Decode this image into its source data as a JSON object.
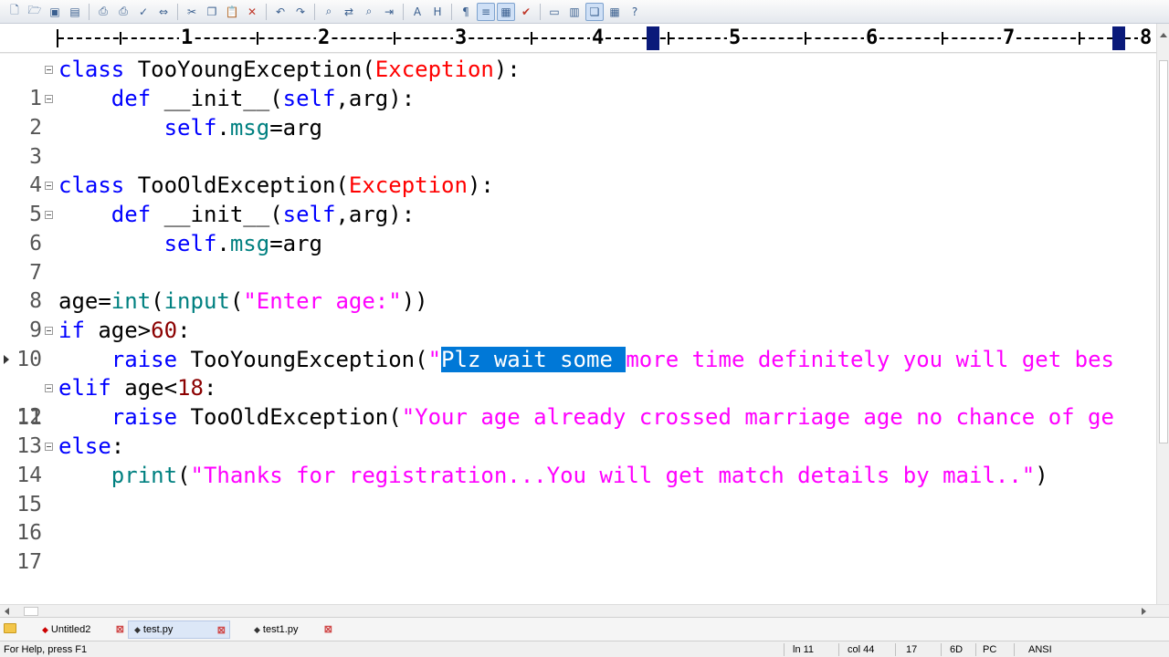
{
  "toolbar": {
    "buttons": [
      "new-file-icon",
      "open-folder-icon",
      "save-icon",
      "save-all-icon",
      "print-preview-icon",
      "print-icon",
      "spellcheck-icon",
      "compare-icon",
      "cut-icon",
      "copy-icon",
      "paste-icon",
      "delete-icon",
      "undo-icon",
      "redo-icon",
      "find-icon",
      "replace-icon",
      "find-in-files-icon",
      "goto-icon",
      "font-icon",
      "hex-icon",
      "format-icon",
      "word-wrap-icon",
      "column-mode-icon",
      "check-icon",
      "window-icon",
      "window-tile-icon",
      "window-cascade-icon",
      "window-arrange-icon",
      "help-icon"
    ]
  },
  "ruler": {
    "numbers": [
      "1",
      "2",
      "3",
      "4",
      "5",
      "6",
      "7",
      "8"
    ]
  },
  "editor": {
    "lines": [
      {
        "num": "1",
        "fold": true
      },
      {
        "num": "2",
        "fold": true
      },
      {
        "num": "3"
      },
      {
        "num": "4"
      },
      {
        "num": "5",
        "fold": true
      },
      {
        "num": "6",
        "fold": true
      },
      {
        "num": "7"
      },
      {
        "num": "8"
      },
      {
        "num": "9"
      },
      {
        "num": "10",
        "fold": true
      },
      {
        "num": "11",
        "current": true
      },
      {
        "num": "12",
        "fold": true
      },
      {
        "num": "13"
      },
      {
        "num": "14",
        "fold": true
      },
      {
        "num": "15"
      },
      {
        "num": "16"
      },
      {
        "num": "17"
      }
    ],
    "tokens": {
      "l1_class": "class",
      "l1_name": " TooYoungException(",
      "l1_base": "Exception",
      "l1_end": "):",
      "l2_indent": "    ",
      "l2_def": "def",
      "l2_mid": " __init__(",
      "l2_self": "self",
      "l2_end": ",arg):",
      "l3_indent": "        ",
      "l3_self": "self",
      "l3_dot": ".",
      "l3_msg": "msg",
      "l3_end": "=arg",
      "l5_class": "class",
      "l5_name": " TooOldException(",
      "l5_base": "Exception",
      "l5_end": "):",
      "l6_indent": "    ",
      "l6_def": "def",
      "l6_mid": " __init__(",
      "l6_self": "self",
      "l6_end": ",arg):",
      "l7_indent": "        ",
      "l7_self": "self",
      "l7_dot": ".",
      "l7_msg": "msg",
      "l7_end": "=arg",
      "l9_age": "age=",
      "l9_int": "int",
      "l9_p1": "(",
      "l9_input": "input",
      "l9_p2": "(",
      "l9_str": "\"Enter age:\"",
      "l9_end": "))",
      "l10_if": "if",
      "l10_mid": " age>",
      "l10_num": "60",
      "l10_end": ":",
      "l11_indent": "    ",
      "l11_raise": "raise",
      "l11_mid": " TooYoungException(",
      "l11_q": "\"",
      "l11_sel": "Plz wait some ",
      "l11_rest": "more time definitely you will get bes",
      "l12_elif": "elif",
      "l12_mid": " age<",
      "l12_num": "18",
      "l12_end": ":",
      "l13_indent": "    ",
      "l13_raise": "raise",
      "l13_mid": " TooOldException(",
      "l13_str": "\"Your age already crossed marriage age no chance of ge",
      "l14_else": "else",
      "l14_end": ":",
      "l15_indent": "    ",
      "l15_print": "print",
      "l15_p": "(",
      "l15_str": "\"Thanks for registration...You will get match details by mail..\"",
      "l15_end": ")"
    }
  },
  "tabs": [
    {
      "label": "Untitled2",
      "active": false
    },
    {
      "label": "test.py",
      "active": true
    },
    {
      "label": "test1.py",
      "active": false
    }
  ],
  "status": {
    "help": "For Help, press F1",
    "line": "ln 11",
    "col": "col 44",
    "total": "17",
    "hex": "6D",
    "eol": "PC",
    "encoding": "ANSI"
  },
  "colors": {
    "keyword": "#0000ff",
    "builtin": "#008080",
    "string": "#ff00ff",
    "type": "#ff0000",
    "number": "#8b0000",
    "selection": "#0078d7"
  }
}
